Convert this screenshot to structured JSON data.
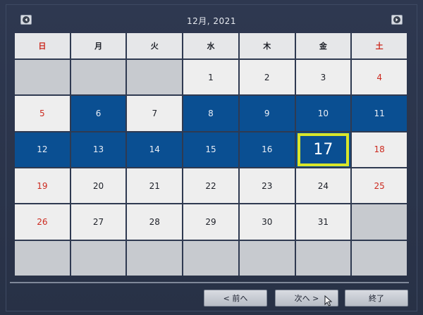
{
  "header": {
    "title": "12月, 2021"
  },
  "weekdays": [
    {
      "label": "日",
      "kind": "sun"
    },
    {
      "label": "月",
      "kind": "wk"
    },
    {
      "label": "火",
      "kind": "wk"
    },
    {
      "label": "水",
      "kind": "wk"
    },
    {
      "label": "木",
      "kind": "wk"
    },
    {
      "label": "金",
      "kind": "wk"
    },
    {
      "label": "土",
      "kind": "sat"
    }
  ],
  "weeks": [
    [
      {
        "day": "",
        "state": "empty"
      },
      {
        "day": "",
        "state": "empty"
      },
      {
        "day": "",
        "state": "empty"
      },
      {
        "day": "1",
        "state": "normal"
      },
      {
        "day": "2",
        "state": "normal"
      },
      {
        "day": "3",
        "state": "normal"
      },
      {
        "day": "4",
        "state": "normal"
      }
    ],
    [
      {
        "day": "5",
        "state": "normal"
      },
      {
        "day": "6",
        "state": "recorded"
      },
      {
        "day": "7",
        "state": "normal"
      },
      {
        "day": "8",
        "state": "recorded"
      },
      {
        "day": "9",
        "state": "recorded"
      },
      {
        "day": "10",
        "state": "recorded"
      },
      {
        "day": "11",
        "state": "recorded"
      }
    ],
    [
      {
        "day": "12",
        "state": "recorded"
      },
      {
        "day": "13",
        "state": "recorded"
      },
      {
        "day": "14",
        "state": "recorded"
      },
      {
        "day": "15",
        "state": "recorded"
      },
      {
        "day": "16",
        "state": "recorded"
      },
      {
        "day": "17",
        "state": "selected"
      },
      {
        "day": "18",
        "state": "normal"
      }
    ],
    [
      {
        "day": "19",
        "state": "normal"
      },
      {
        "day": "20",
        "state": "normal"
      },
      {
        "day": "21",
        "state": "normal"
      },
      {
        "day": "22",
        "state": "normal"
      },
      {
        "day": "23",
        "state": "normal"
      },
      {
        "day": "24",
        "state": "normal"
      },
      {
        "day": "25",
        "state": "normal"
      }
    ],
    [
      {
        "day": "26",
        "state": "normal"
      },
      {
        "day": "27",
        "state": "normal"
      },
      {
        "day": "28",
        "state": "normal"
      },
      {
        "day": "29",
        "state": "normal"
      },
      {
        "day": "30",
        "state": "normal"
      },
      {
        "day": "31",
        "state": "normal"
      },
      {
        "day": "",
        "state": "empty"
      }
    ],
    [
      {
        "day": "",
        "state": "empty"
      },
      {
        "day": "",
        "state": "empty"
      },
      {
        "day": "",
        "state": "empty"
      },
      {
        "day": "",
        "state": "empty"
      },
      {
        "day": "",
        "state": "empty"
      },
      {
        "day": "",
        "state": "empty"
      },
      {
        "day": "",
        "state": "empty"
      }
    ]
  ],
  "footer": {
    "prev_label": "< 前へ",
    "next_label": "次へ >",
    "close_label": "終了"
  },
  "icons": {
    "prev_month": "chevron-left-icon",
    "next_month": "chevron-right-icon",
    "cursor": "mouse-pointer-icon"
  },
  "colors": {
    "recorded": "#0a4f92",
    "selected_ring": "#d9e62a",
    "weekend_text": "#cc2a1f",
    "empty_cell": "#c7cacf",
    "normal_cell": "#eeeeee",
    "background": "#2b3449"
  }
}
